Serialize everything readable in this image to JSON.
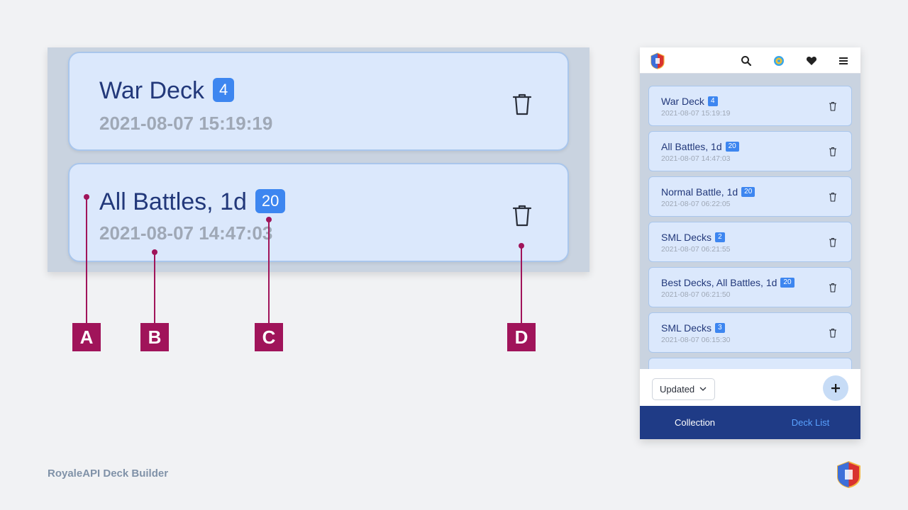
{
  "zoom": {
    "cards": [
      {
        "title": "War Deck",
        "count": "4",
        "date": "2021-08-07 15:19:19"
      },
      {
        "title": "All Battles, 1d",
        "count": "20",
        "date": "2021-08-07 14:47:03"
      }
    ]
  },
  "callouts": [
    "A",
    "B",
    "C",
    "D"
  ],
  "phone": {
    "header_icons": [
      "search-icon",
      "target-icon",
      "heart-icon",
      "menu-icon"
    ],
    "decks": [
      {
        "title": "War Deck",
        "count": "4",
        "date": "2021-08-07 15:19:19"
      },
      {
        "title": "All Battles, 1d",
        "count": "20",
        "date": "2021-08-07 14:47:03"
      },
      {
        "title": "Normal Battle, 1d",
        "count": "20",
        "date": "2021-08-07 06:22:05"
      },
      {
        "title": "SML Decks",
        "count": "2",
        "date": "2021-08-07 06:21:55"
      },
      {
        "title": "Best Decks, All Battles, 1d",
        "count": "20",
        "date": "2021-08-07 06:21:50"
      },
      {
        "title": "SML Decks",
        "count": "3",
        "date": "2021-08-07 06:15:30"
      }
    ],
    "sort_value": "Updated",
    "tabs": [
      {
        "label": "Collection",
        "active": false
      },
      {
        "label": "Deck List",
        "active": true
      }
    ]
  },
  "colors": {
    "accent": "#3d86f0",
    "navy": "#1f3b86",
    "callout": "#a0145a",
    "card_bg": "#dbe8fc",
    "active_tab": "#5aa2ff"
  },
  "footer": {
    "title": "RoyaleAPI Deck Builder"
  }
}
